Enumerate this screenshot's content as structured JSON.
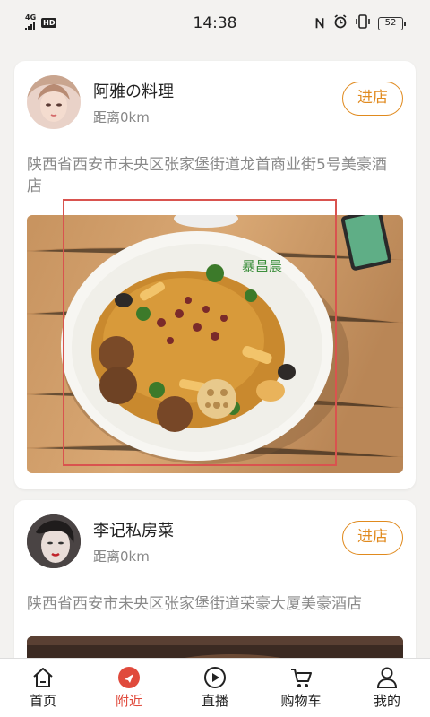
{
  "status_bar": {
    "network": "4G",
    "hd": "HD",
    "time": "14:38",
    "battery": "52",
    "icons": [
      "nfc-icon",
      "alarm-icon",
      "vibrate-icon",
      "battery-icon"
    ]
  },
  "shops": [
    {
      "name": "阿雅の料理",
      "distance": "距离0km",
      "enter_label": "进店",
      "address": "陕西省西安市未央区张家堡街道龙首商业街5号美豪酒店",
      "photo_sign": "暴昌晨"
    },
    {
      "name": "李记私房菜",
      "distance": "距离0km",
      "enter_label": "进店",
      "address": "陕西省西安市未央区张家堡街道荣豪大厦美豪酒店"
    }
  ],
  "bottom_nav": {
    "items": [
      {
        "label": "首页",
        "icon": "home-icon"
      },
      {
        "label": "附近",
        "icon": "nearby-icon"
      },
      {
        "label": "直播",
        "icon": "live-play-icon"
      },
      {
        "label": "购物车",
        "icon": "cart-icon"
      },
      {
        "label": "我的",
        "icon": "profile-icon"
      }
    ],
    "active_index": 1
  },
  "colors": {
    "accent": "#e08a1e",
    "active_nav": "#e04a3c",
    "highlight_box": "#d9534f"
  }
}
